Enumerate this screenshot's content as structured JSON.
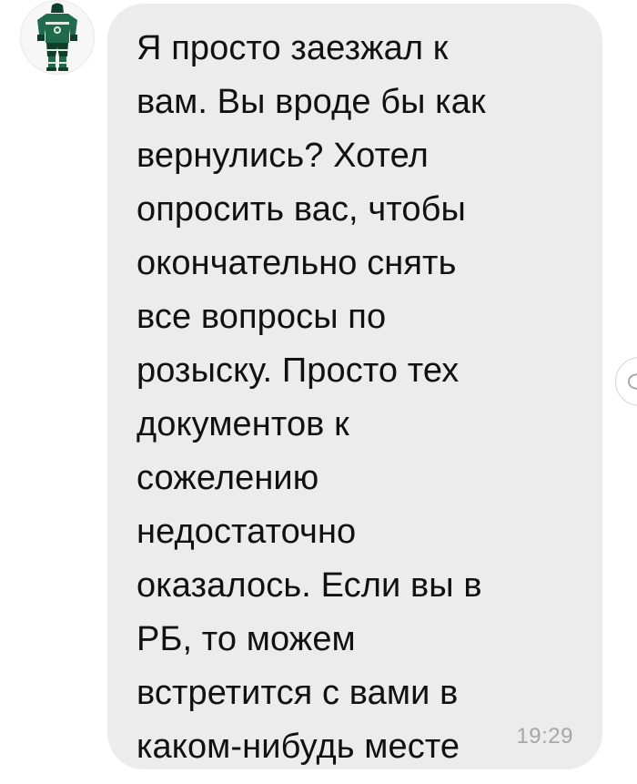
{
  "sender": {
    "avatar_icon": "hockey-uniform-icon",
    "colors": {
      "jersey": "#1f6b4b",
      "jersey_dark": "#0f3f2b",
      "stripe": "#dfe9e3"
    }
  },
  "message": {
    "lines": [
      "Я просто заезжал к",
      "вам. Вы вроде бы как",
      "вернулись? Хотел",
      "опросить вас, чтобы",
      "окончательно снять",
      "все вопросы по",
      "розыску. Просто тех",
      "документов к",
      "сожелению",
      "недостаточно",
      "оказалось. Если вы в",
      "РБ, то можем",
      "встретится с вами в",
      "каком-нибудь месте"
    ],
    "time": "19:29"
  },
  "side_action": {
    "icon": "reaction-icon"
  },
  "theme": {
    "bubble_bg": "#ececec",
    "text_color": "#111111",
    "time_color": "#a6a6a6"
  }
}
